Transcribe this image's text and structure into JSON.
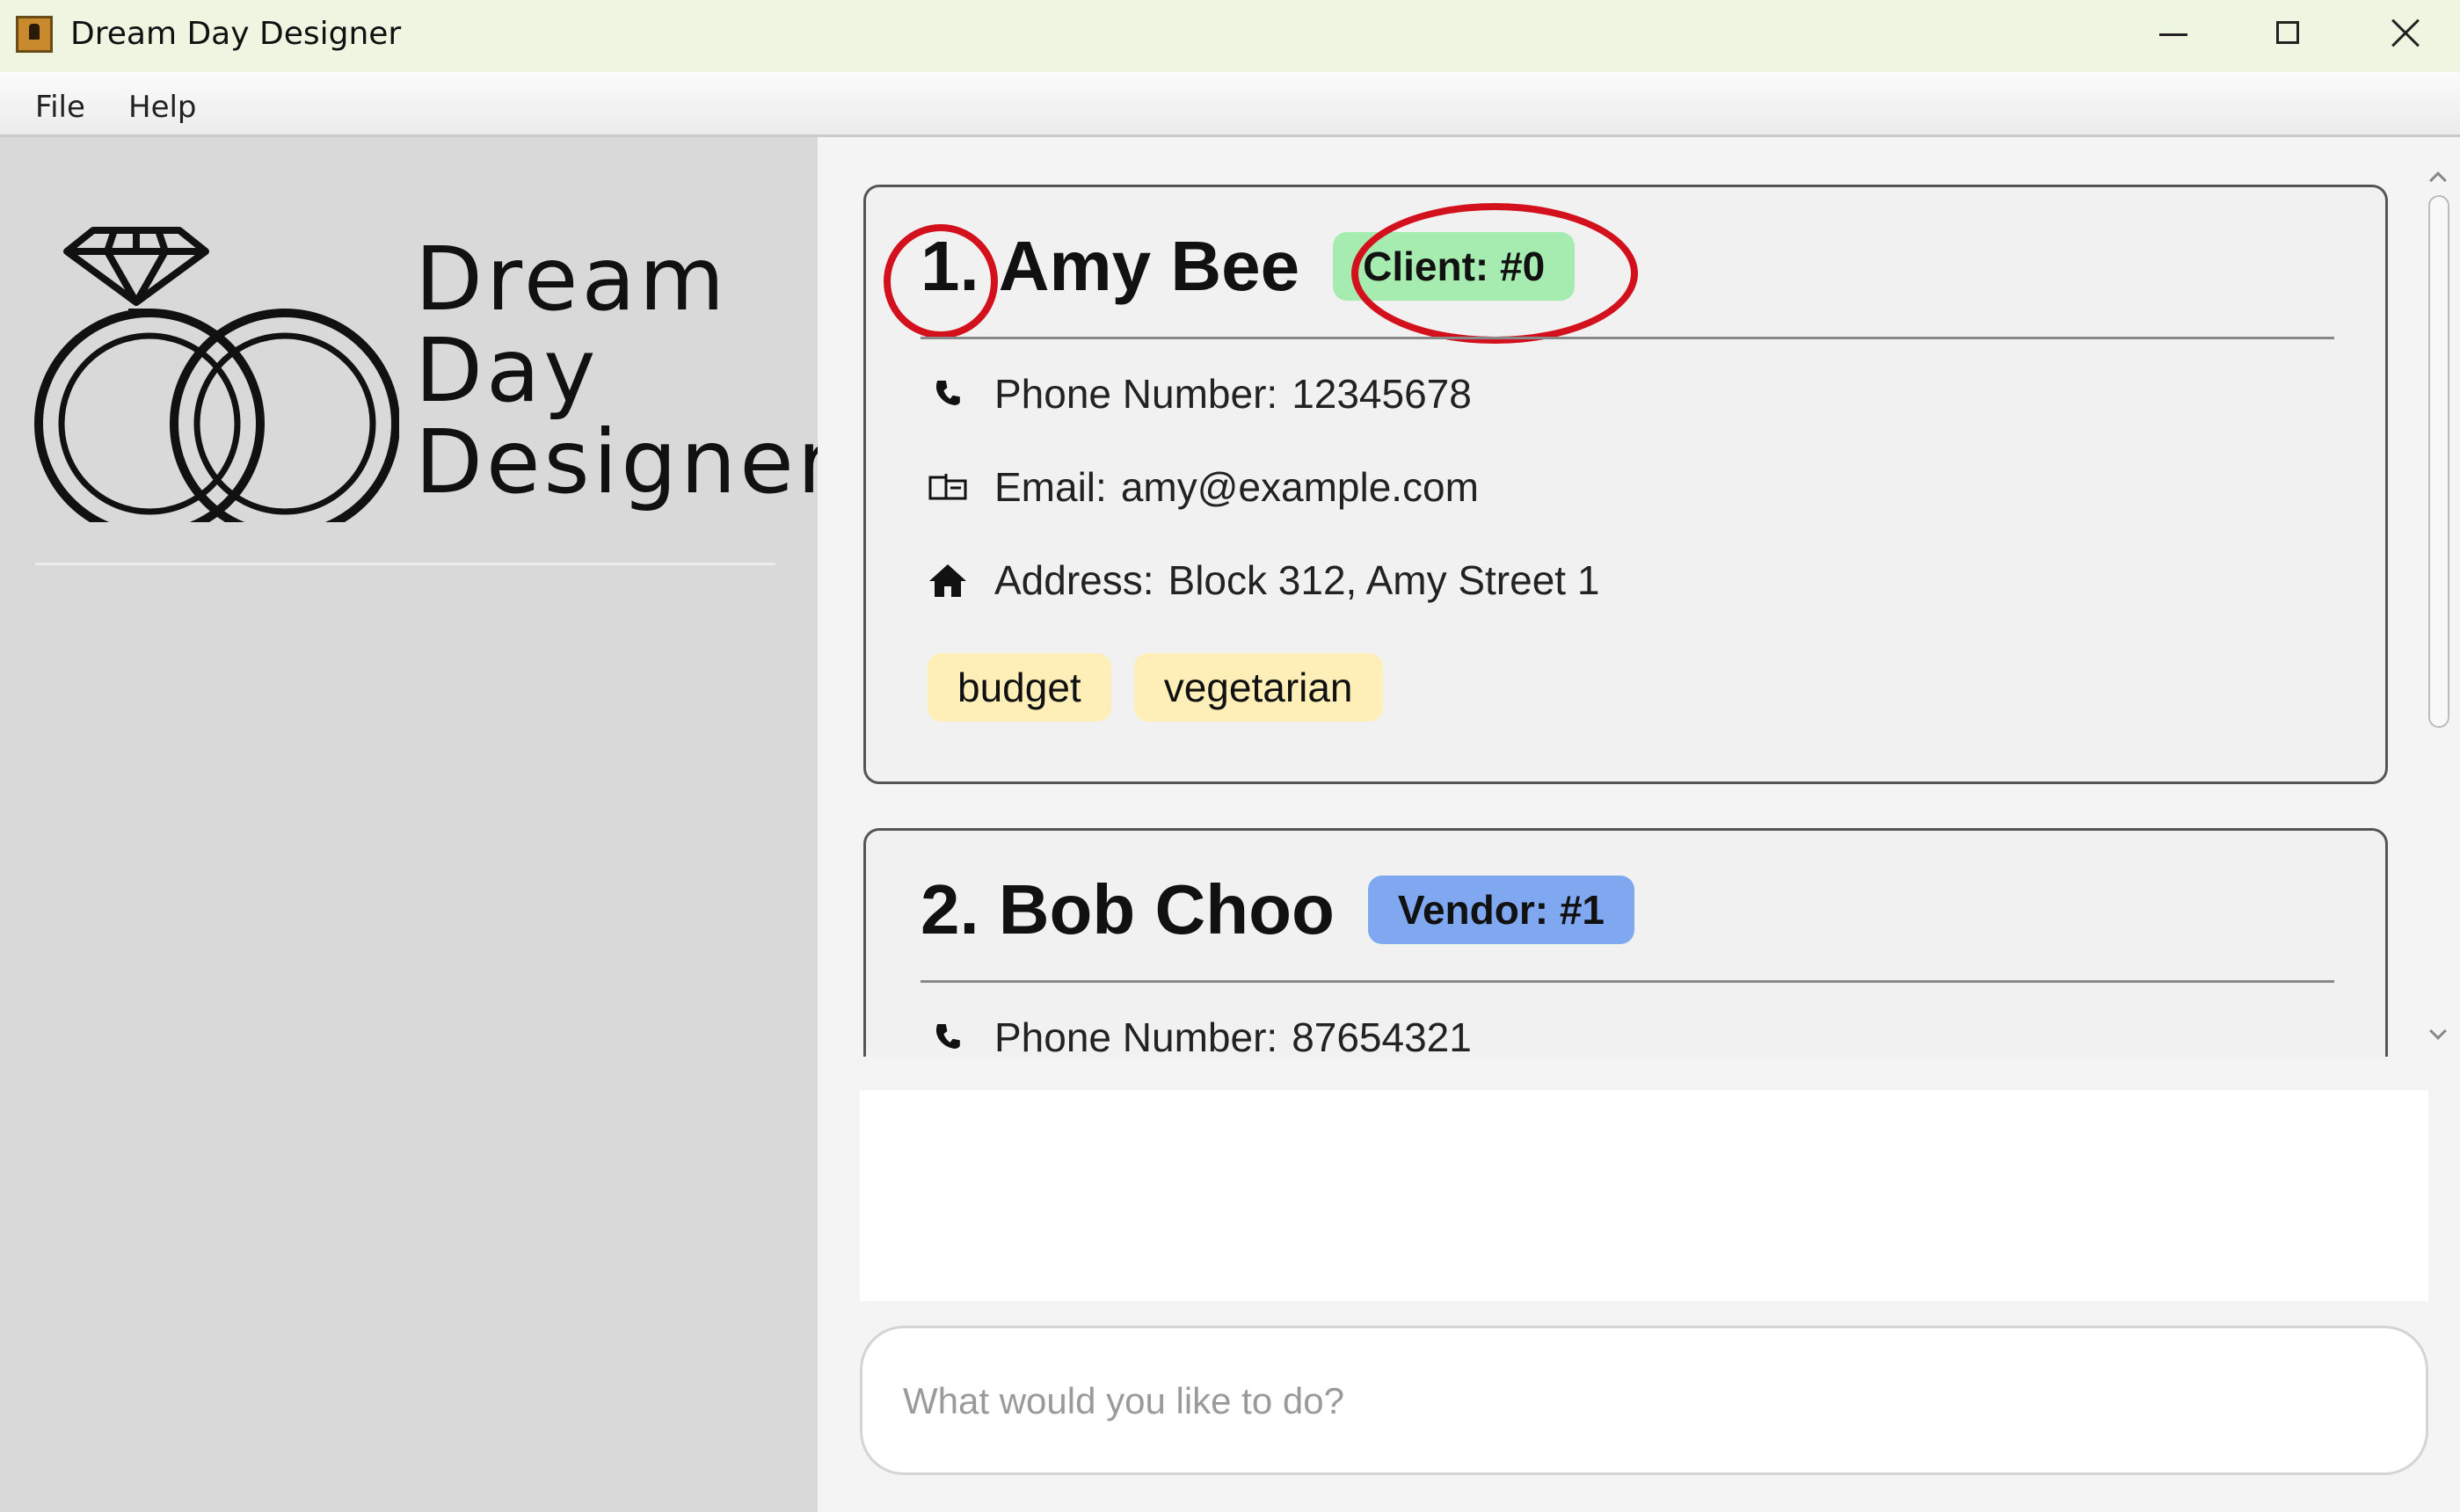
{
  "window": {
    "title": "Dream Day Designer"
  },
  "menu": {
    "file": "File",
    "help": "Help"
  },
  "sidebar": {
    "logo_lines": [
      "Dream",
      "Day",
      "Designer"
    ]
  },
  "contacts": [
    {
      "index": "1.",
      "name": "Amy Bee",
      "badge": "Client: #0",
      "badge_color": "#a6ecb0",
      "phone_label": "Phone Number:",
      "phone": "12345678",
      "email_label": "Email:",
      "email": "amy@example.com",
      "address_label": "Address:",
      "address": "Block 312, Amy Street 1",
      "tags": [
        "budget",
        "vegetarian"
      ],
      "annotated": true
    },
    {
      "index": "2.",
      "name": "Bob Choo",
      "badge": "Vendor: #1",
      "badge_color": "#7fa8f0",
      "phone_label": "Phone Number:",
      "phone": "87654321"
    }
  ],
  "result_display": {
    "text": ""
  },
  "command": {
    "placeholder": "What would you like to do?",
    "value": ""
  },
  "colors": {
    "annotation": "#d3111d",
    "tag_bg": "#fdefb7",
    "sidebar_bg": "#d9d9d9"
  }
}
